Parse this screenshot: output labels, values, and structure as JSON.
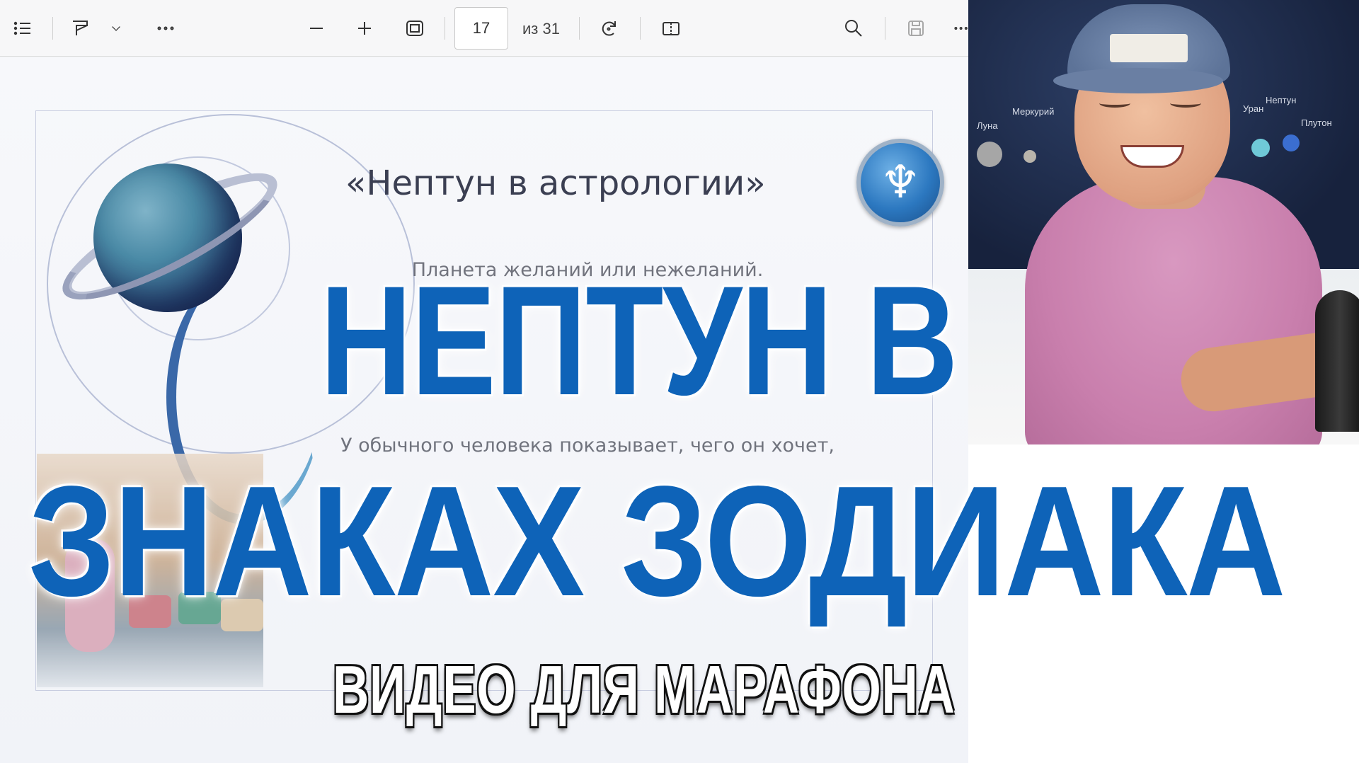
{
  "toolbar": {
    "current_page": "17",
    "page_total": "из 31",
    "icons": [
      "contents-icon",
      "draw-icon",
      "chevron-down-icon",
      "more-icon",
      "zoom-out-icon",
      "zoom-in-icon",
      "fit-page-icon",
      "rotate-icon",
      "page-view-icon",
      "search-icon",
      "save-icon",
      "more-icon"
    ]
  },
  "slide": {
    "title": "«Нептун в астрологии»",
    "badge_symbol": "♆",
    "body_lines": [
      "Планета желаний или нежеланий.",
      "",
      "",
      "",
      "У обычного человека показывает, чего он хочет,",
      "",
      "",
      ""
    ]
  },
  "webcam": {
    "wall_labels": [
      "Меркурий",
      "Луна",
      "Уран",
      "Нептун",
      "Плутон"
    ]
  },
  "overlay": {
    "line1": "НЕПТУН В",
    "line2": "ЗНАКАХ ЗОДИАКА",
    "subtitle": "ВИДЕО ДЛЯ МАРАФОНА"
  },
  "colors": {
    "headline": "#0e63b8",
    "shirt": "#c97fad",
    "badge": "#2c78c0"
  }
}
